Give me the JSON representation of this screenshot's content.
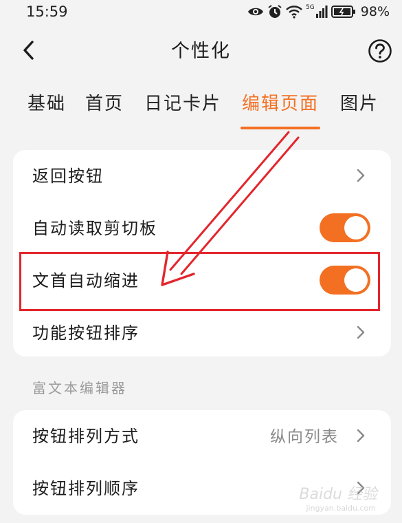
{
  "status_bar": {
    "time": "15:59",
    "battery": "98%",
    "network": "5G",
    "icons": [
      "eye-icon",
      "alarm-icon",
      "wifi-icon",
      "signal-icon",
      "battery-icon"
    ]
  },
  "header": {
    "title": "个性化",
    "back_icon": "chevron-left-icon",
    "help_icon": "question-circle-icon"
  },
  "tabs": [
    {
      "label": "基础",
      "active": false
    },
    {
      "label": "首页",
      "active": false
    },
    {
      "label": "日记卡片",
      "active": false
    },
    {
      "label": "编辑页面",
      "active": true
    },
    {
      "label": "图片",
      "active": false
    }
  ],
  "settings_card": {
    "rows": [
      {
        "label": "返回按钮",
        "type": "link"
      },
      {
        "label": "自动读取剪切板",
        "type": "toggle",
        "on": true
      },
      {
        "label": "文首自动缩进",
        "type": "toggle",
        "on": true
      },
      {
        "label": "功能按钮排序",
        "type": "link"
      }
    ]
  },
  "rich_text_section": {
    "title": "富文本编辑器",
    "rows": [
      {
        "label": "按钮排列方式",
        "value": "纵向列表",
        "type": "link"
      },
      {
        "label": "按钮排列顺序",
        "type": "link"
      }
    ]
  },
  "colors": {
    "accent": "#f37023",
    "annotation": "#e3262d",
    "background": "#f3f3f3"
  },
  "watermark": {
    "text": "Baidu 经验",
    "sub": "jingyan.baidu.com"
  }
}
